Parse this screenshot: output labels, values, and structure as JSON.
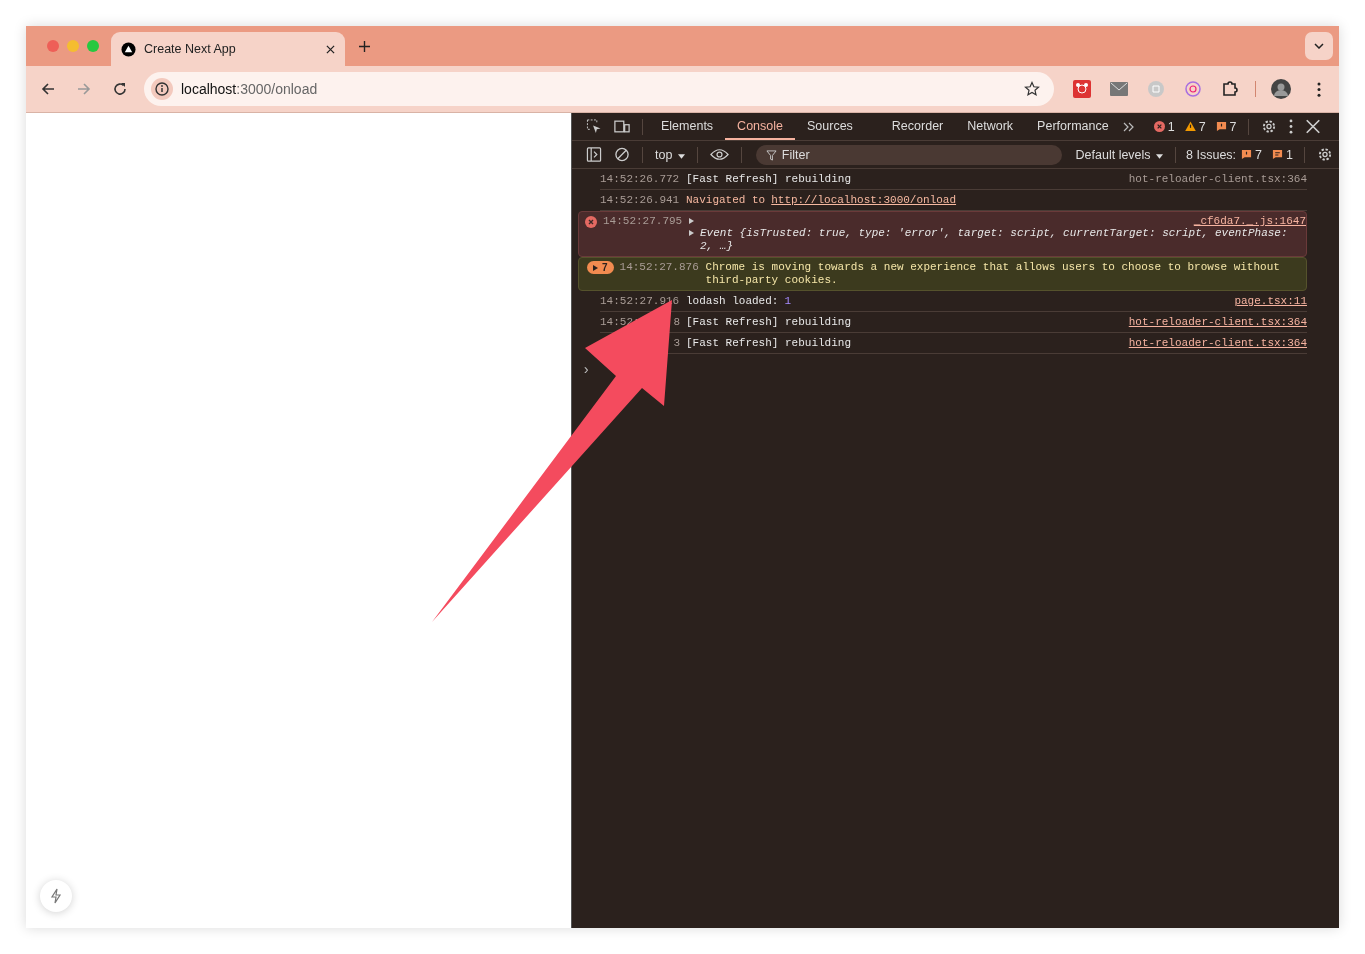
{
  "browser": {
    "tab": {
      "title": "Create Next App",
      "selected": true
    },
    "address": {
      "host": "localhost",
      "path": ":3000/onload"
    }
  },
  "devtools": {
    "tabs": [
      {
        "label": "Elements",
        "selected": false
      },
      {
        "label": "Console",
        "selected": true
      },
      {
        "label": "Sources",
        "selected": false
      },
      {
        "label": "Recorder",
        "selected": false
      },
      {
        "label": "Network",
        "selected": false
      },
      {
        "label": "Performance",
        "selected": false
      }
    ],
    "counts": {
      "errors": "1",
      "warnings": "7",
      "issues": "7"
    },
    "toolbar": {
      "context": "top",
      "filter_placeholder": "Filter",
      "levels": "Default levels",
      "issues_label": "8 Issues:",
      "issues_warnings": "7",
      "issues_info": "1"
    },
    "messages": [
      {
        "kind": "log",
        "time": "14:52:26.772",
        "text": "[Fast Refresh] rebuilding",
        "source": "hot-reloader-client.tsx:364",
        "source_link": false
      },
      {
        "kind": "navigation",
        "time": "14:52:26.941",
        "text": "Navigated to",
        "link": "http://localhost:3000/onload"
      },
      {
        "kind": "error",
        "time": "14:52:27.795",
        "source": "_cf6da7._.js:1647",
        "object": "Event {*isTrusted*: true, *type*: 'error', *target*: script, *currentTarget*: script, *eventPhase*: 2, …}"
      },
      {
        "kind": "issue",
        "badge": "7",
        "time": "14:52:27.876",
        "text": "Chrome is moving towards a new experience that allows users to choose to browse without third-party cookies."
      },
      {
        "kind": "log",
        "time": "14:52:27.916",
        "text": "lodash loaded:",
        "number": "1",
        "source": "page.tsx:11",
        "source_link": true
      },
      {
        "kind": "log",
        "time": "14:52:",
        "time_tail": "8",
        "text": "[Fast Refresh] rebuilding",
        "source": "hot-reloader-client.tsx:364",
        "source_link": true
      },
      {
        "kind": "log",
        "time_tail": "3",
        "text": "[Fast Refresh] rebuilding",
        "source": "hot-reloader-client.tsx:364",
        "source_link": true
      }
    ],
    "prompt": "›"
  }
}
